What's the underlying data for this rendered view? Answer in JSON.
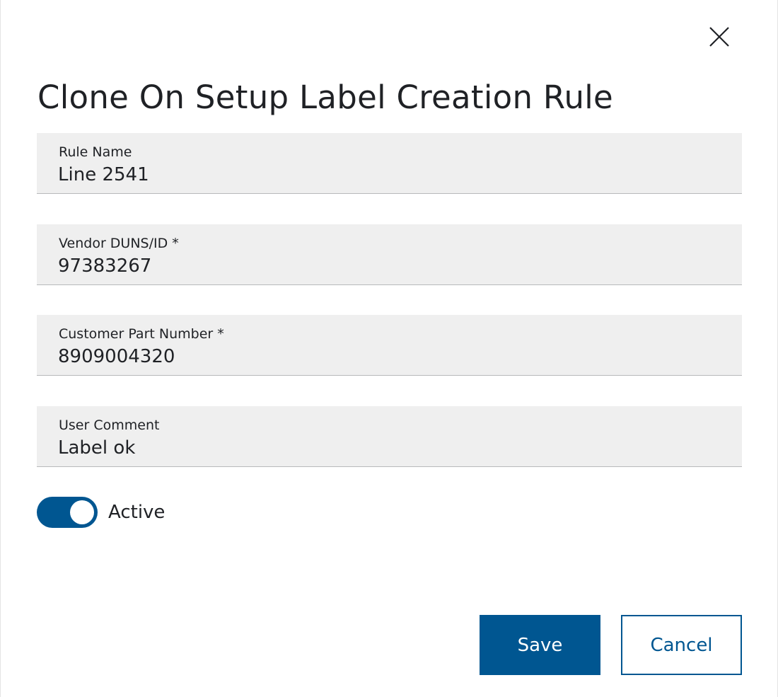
{
  "dialog": {
    "title": "Clone On Setup Label Creation Rule",
    "close_icon": "close-icon"
  },
  "fields": [
    {
      "label": "Rule Name",
      "value": "Line 2541"
    },
    {
      "label": "Vendor DUNS/ID *",
      "value": "97383267"
    },
    {
      "label": "Customer Part Number *",
      "value": "8909004320"
    },
    {
      "label": "User Comment",
      "value": "Label ok"
    }
  ],
  "active_toggle": {
    "label": "Active",
    "checked": true
  },
  "buttons": {
    "save_label": "Save",
    "cancel_label": "Cancel"
  },
  "colors": {
    "accent": "#005691",
    "field_background": "#efefef",
    "text": "#1f2125"
  }
}
